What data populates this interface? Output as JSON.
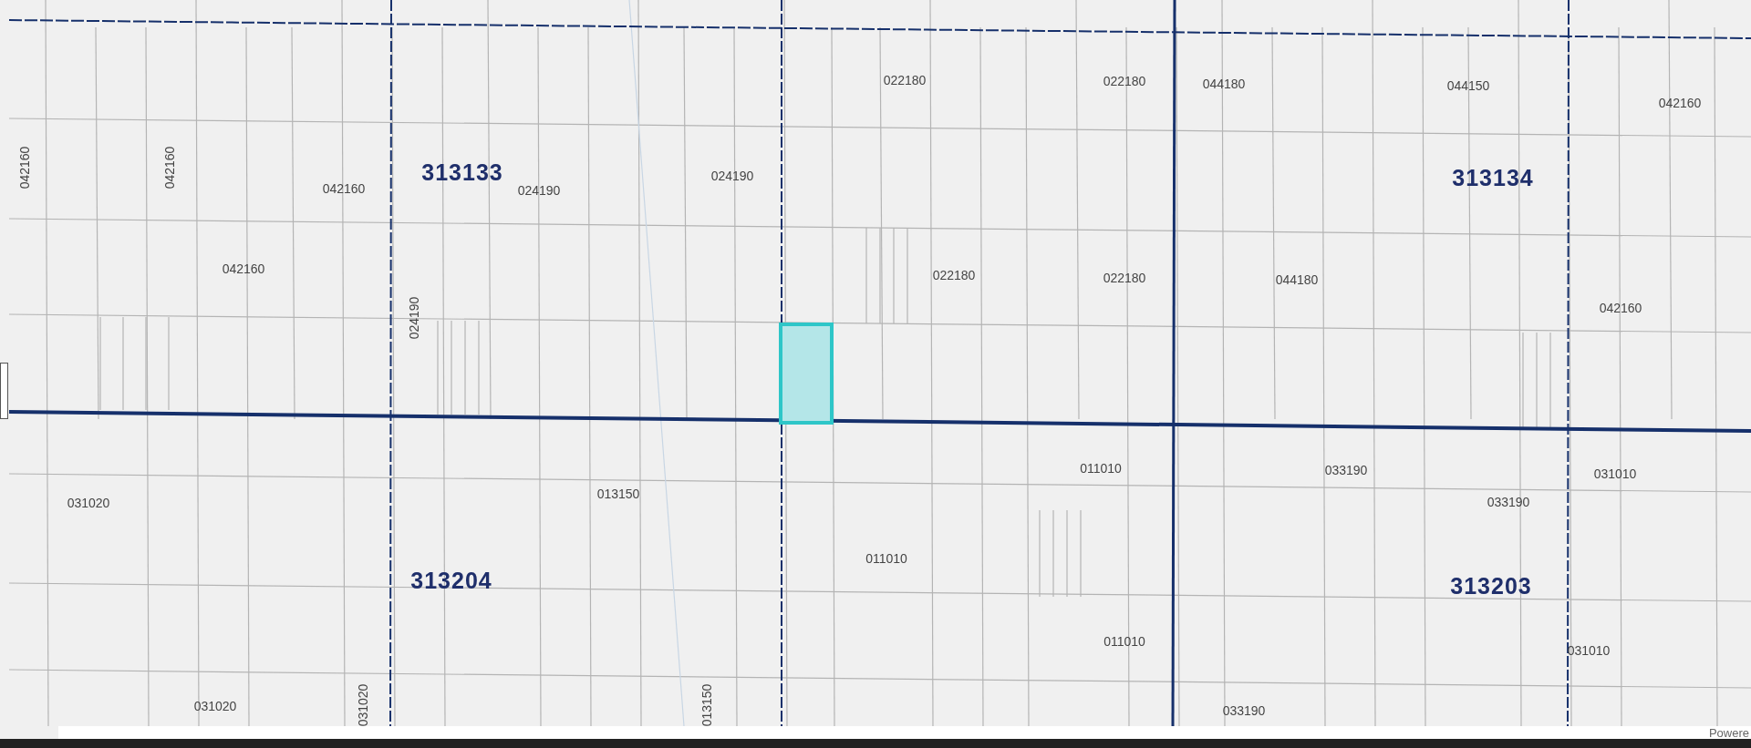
{
  "map": {
    "section_labels": [
      "313133",
      "313134",
      "313204",
      "313203"
    ],
    "parcel_labels": [
      {
        "text": "022180",
        "kind": "horizontal"
      },
      {
        "text": "022180",
        "kind": "horizontal"
      },
      {
        "text": "044180",
        "kind": "horizontal"
      },
      {
        "text": "044150",
        "kind": "horizontal"
      },
      {
        "text": "042160",
        "kind": "horizontal"
      },
      {
        "text": "042160",
        "kind": "vertical"
      },
      {
        "text": "042160",
        "kind": "vertical"
      },
      {
        "text": "042160",
        "kind": "horizontal"
      },
      {
        "text": "024190",
        "kind": "horizontal"
      },
      {
        "text": "024190",
        "kind": "horizontal"
      },
      {
        "text": "042160",
        "kind": "horizontal"
      },
      {
        "text": "024190",
        "kind": "vertical"
      },
      {
        "text": "022180",
        "kind": "horizontal"
      },
      {
        "text": "022180",
        "kind": "horizontal"
      },
      {
        "text": "044180",
        "kind": "horizontal"
      },
      {
        "text": "042160",
        "kind": "horizontal"
      },
      {
        "text": "031020",
        "kind": "horizontal"
      },
      {
        "text": "013150",
        "kind": "horizontal"
      },
      {
        "text": "011010",
        "kind": "horizontal"
      },
      {
        "text": "033190",
        "kind": "horizontal"
      },
      {
        "text": "031010",
        "kind": "horizontal"
      },
      {
        "text": "033190",
        "kind": "horizontal"
      },
      {
        "text": "011010",
        "kind": "horizontal"
      },
      {
        "text": "011010",
        "kind": "horizontal"
      },
      {
        "text": "031010",
        "kind": "horizontal"
      },
      {
        "text": "031020",
        "kind": "horizontal"
      },
      {
        "text": "031020",
        "kind": "vertical"
      },
      {
        "text": "013150",
        "kind": "vertical"
      },
      {
        "text": "033190",
        "kind": "horizontal"
      }
    ],
    "selected_parcel": {
      "selected": true
    }
  },
  "attribution": {
    "text": "Powere"
  }
}
